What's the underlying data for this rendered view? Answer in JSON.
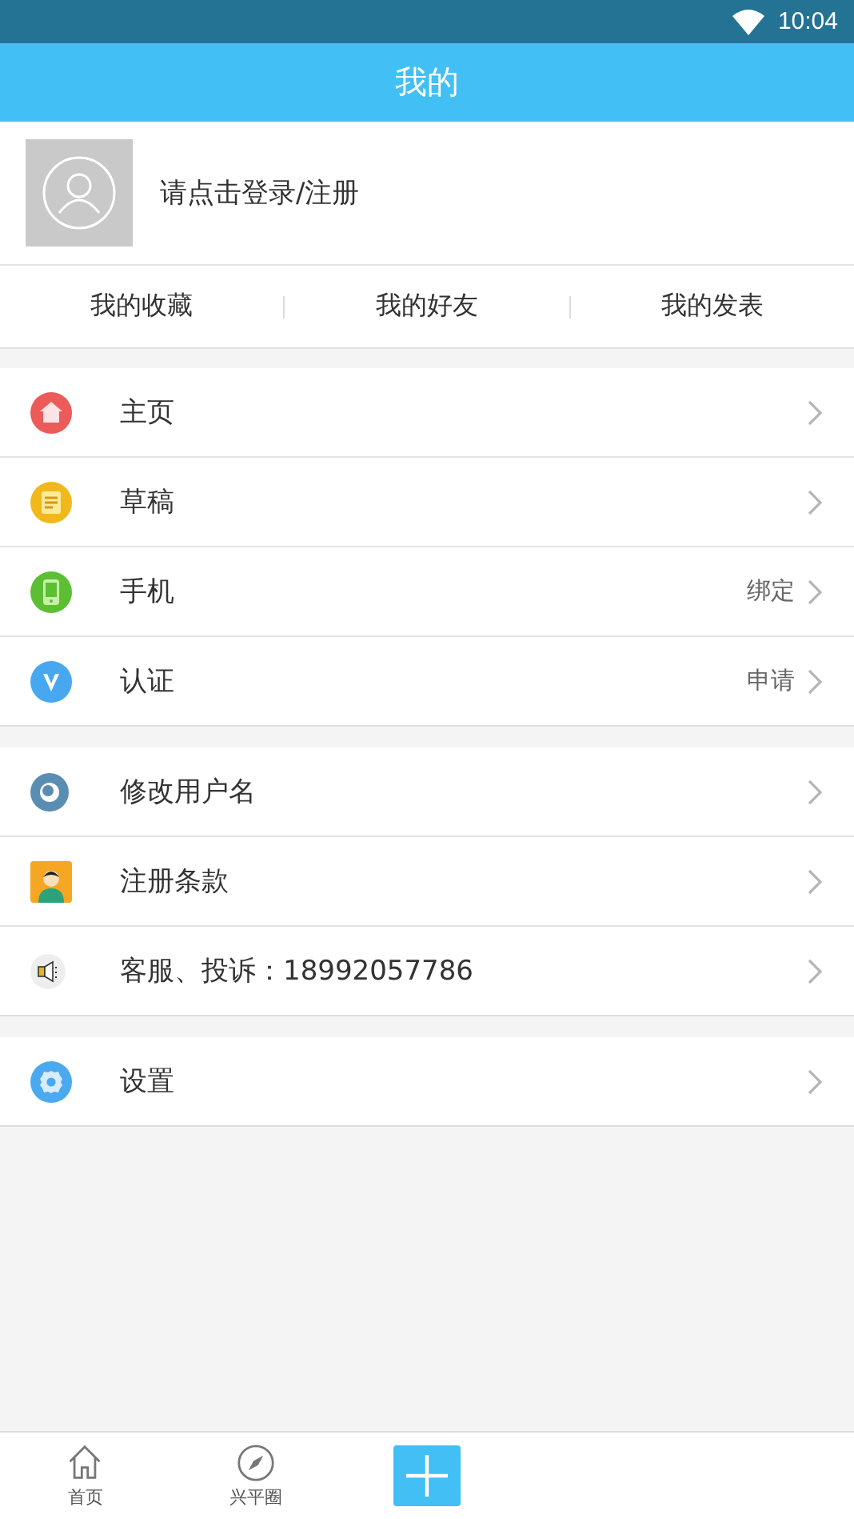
{
  "status_bar": {
    "time": "10:04"
  },
  "header": {
    "title": "我的"
  },
  "profile": {
    "login_text": "请点击登录/注册"
  },
  "quick_links": [
    {
      "label": "我的收藏"
    },
    {
      "label": "我的好友"
    },
    {
      "label": "我的发表"
    }
  ],
  "menu_groups": [
    [
      {
        "kind": "home",
        "label": "主页"
      },
      {
        "kind": "draft",
        "label": "草稿"
      },
      {
        "kind": "phone",
        "label": "手机",
        "value": "绑定"
      },
      {
        "kind": "verify",
        "label": "认证",
        "value": "申请"
      }
    ],
    [
      {
        "kind": "username",
        "label": "修改用户名"
      },
      {
        "kind": "terms",
        "label": "注册条款"
      },
      {
        "kind": "service",
        "label": "客服、投诉：18992057786"
      }
    ],
    [
      {
        "kind": "settings",
        "label": "设置"
      }
    ]
  ],
  "bottom_nav": [
    {
      "kind": "home",
      "label": "首页"
    },
    {
      "kind": "compass",
      "label": "兴平圈"
    },
    {
      "kind": "add"
    }
  ]
}
